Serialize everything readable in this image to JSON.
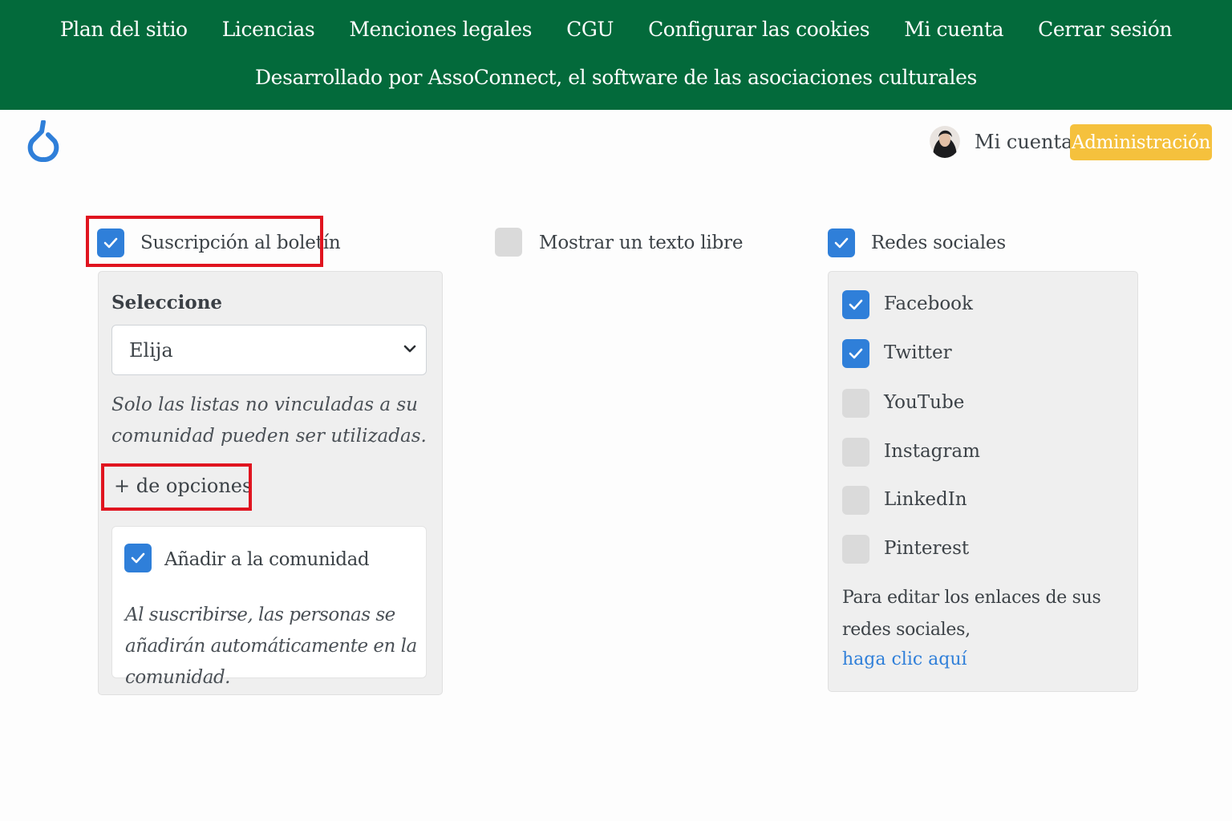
{
  "banner": {
    "links": [
      "Plan del sitio",
      "Licencias",
      "Menciones legales",
      "CGU",
      "Configurar las cookies",
      "Mi cuenta",
      "Cerrar sesión"
    ],
    "powered_by": "Desarrollado por AssoConnect, el software de las asociaciones culturales"
  },
  "header": {
    "account_label": "Mi cuenta",
    "admin_label": "Administración",
    "logo_icon": "assoconnect-logo-icon",
    "avatar_icon": "user-avatar"
  },
  "options": {
    "newsletter": {
      "label": "Suscripción al boletín",
      "checked": true
    },
    "free_text": {
      "label": "Mostrar un texto libre",
      "checked": false
    },
    "social": {
      "label": "Redes sociales",
      "checked": true
    }
  },
  "newsletter_panel": {
    "title": "Seleccione",
    "select_value": "Elija",
    "hint": "Solo las listas no vinculadas a su comunidad pueden ser utilizadas.",
    "more_options": "+ de opciones",
    "add_to_community": {
      "label": "Añadir a la comunidad",
      "checked": true,
      "hint": "Al suscribirse, las personas se añadirán automáticamente en la comunidad."
    }
  },
  "social_panel": {
    "networks": [
      {
        "name": "Facebook",
        "checked": true
      },
      {
        "name": "Twitter",
        "checked": true
      },
      {
        "name": "YouTube",
        "checked": false
      },
      {
        "name": "Instagram",
        "checked": false
      },
      {
        "name": "LinkedIn",
        "checked": false
      },
      {
        "name": "Pinterest",
        "checked": false
      }
    ],
    "edit_text": "Para editar los enlaces de sus redes sociales,",
    "edit_link": "haga clic aquí"
  },
  "colors": {
    "banner": "#036a3b",
    "checkbox_on": "#2f7fd9",
    "checkbox_off": "#dadada",
    "admin_button": "#f5c13d",
    "highlight": "#e0141f",
    "link": "#2f7fd9"
  }
}
